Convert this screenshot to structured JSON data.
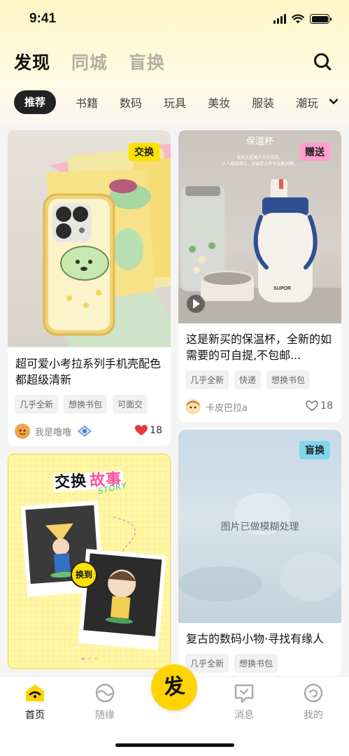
{
  "status_bar": {
    "time": "9:41"
  },
  "header": {
    "tabs": [
      {
        "label": "发现",
        "active": true
      },
      {
        "label": "同城",
        "active": false
      },
      {
        "label": "盲换",
        "active": false
      }
    ]
  },
  "categories": {
    "selected": "推荐",
    "items": [
      "书籍",
      "数码",
      "玩具",
      "美妆",
      "服装",
      "潮玩"
    ]
  },
  "cards": {
    "left1": {
      "badge": "交换",
      "badge_color": "#ffe100",
      "title": "超可爱小考拉系列手机壳配色都超级清新",
      "tags": [
        "几乎全新",
        "想换书包",
        "可面交"
      ],
      "author": "我是噜噜",
      "likes": "18",
      "liked": true
    },
    "right1": {
      "badge": "赠送",
      "badge_color": "#ff9ecf",
      "image_heading": "保温杯",
      "image_caption_1": "超长大超高不开的东西，",
      "image_caption_2": "人人都用得上，进出手几乎不会断问题。",
      "brand": "SUPOR",
      "title": "这是新买的保温杯，全新的如需要的可自提,不包邮...",
      "tags": [
        "几乎全新",
        "快递",
        "想换书包"
      ],
      "author": "卡皮巴拉a",
      "likes": "18",
      "liked": false
    },
    "left2": {
      "banner_title_a": "交换",
      "banner_title_b": "故事",
      "banner_script": "STORY",
      "swap_label": "换到"
    },
    "right2": {
      "badge": "盲换",
      "badge_color": "#7fd8f0",
      "blur_notice": "图片已做模糊处理",
      "title": "复古的数码小物·寻找有缘人",
      "tags": [
        "几乎全新",
        "想换书包"
      ]
    }
  },
  "bottom_nav": {
    "items": [
      {
        "label": "首页",
        "icon": "home-icon",
        "active": true
      },
      {
        "label": "随缘",
        "icon": "random-icon",
        "active": false
      },
      {
        "label": "消息",
        "icon": "message-icon",
        "active": false
      },
      {
        "label": "我的",
        "icon": "profile-icon",
        "active": false
      }
    ],
    "publish_label": "发"
  },
  "colors": {
    "accent": "#ffd400",
    "like_red": "#e83a3a"
  }
}
